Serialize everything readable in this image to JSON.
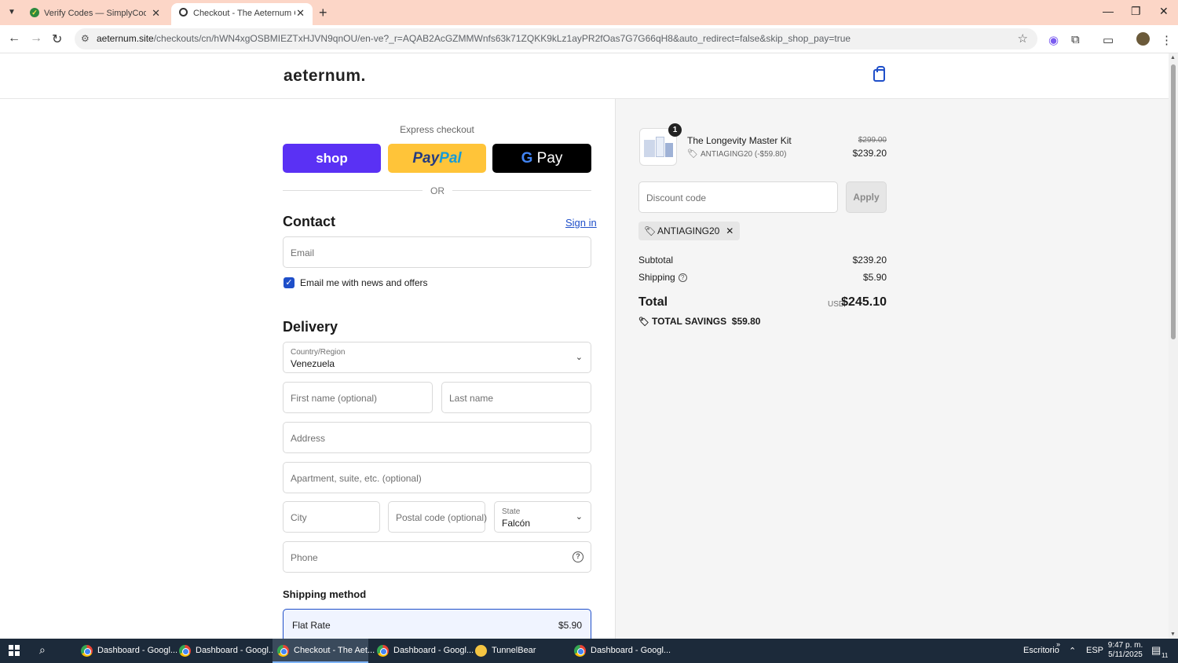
{
  "browser": {
    "tabs": [
      {
        "label": "Verify Codes — SimplyCodes",
        "active": false
      },
      {
        "label": "Checkout - The Aeternum Com",
        "active": true
      }
    ],
    "url_host": "aeternum.site",
    "url_path": "/checkouts/cn/hWN4xgOSBMIEZTxHJVN9qnOU/en-ve?_r=AQAB2AcGZMMWnfs63k71ZQKK9kLz1ayPR2fOas7G7G66qH8&auto_redirect=false&skip_shop_pay=true"
  },
  "store": {
    "logo": "aeternum."
  },
  "express": {
    "heading": "Express checkout",
    "shop_label": "shop",
    "paypal_a": "Pay",
    "paypal_b": "Pal",
    "gpay_g": "G",
    "gpay_label": "Pay",
    "or_label": "OR"
  },
  "contact": {
    "heading": "Contact",
    "signin_label": "Sign in",
    "email_placeholder": "Email",
    "newsletter_label": "Email me with news and offers",
    "newsletter_checked": true
  },
  "delivery": {
    "heading": "Delivery",
    "country_label": "Country/Region",
    "country_value": "Venezuela",
    "first_name_placeholder": "First name (optional)",
    "last_name_placeholder": "Last name",
    "address_placeholder": "Address",
    "apartment_placeholder": "Apartment, suite, etc. (optional)",
    "city_placeholder": "City",
    "postal_placeholder": "Postal code (optional)",
    "state_label": "State",
    "state_value": "Falcón",
    "phone_placeholder": "Phone"
  },
  "shipping_method": {
    "heading": "Shipping method",
    "option_name": "Flat Rate",
    "option_price": "$5.90"
  },
  "summary": {
    "item": {
      "name": "The Longevity Master Kit",
      "quantity": "1",
      "discount_line": "ANTIAGING20 (-$59.80)",
      "original_price": "$299.00",
      "price": "$239.20"
    },
    "discount_placeholder": "Discount code",
    "apply_label": "Apply",
    "applied_code": "ANTIAGING20",
    "subtotal_label": "Subtotal",
    "subtotal_value": "$239.20",
    "shipping_label": "Shipping",
    "shipping_value": "$5.90",
    "total_label": "Total",
    "total_currency": "USD",
    "total_value": "$245.10",
    "savings_label": "TOTAL SAVINGS",
    "savings_value": "$59.80"
  },
  "taskbar": {
    "apps": [
      {
        "label": "Dashboard - Googl...",
        "active": false
      },
      {
        "label": "Dashboard - Googl...",
        "active": false
      },
      {
        "label": "Checkout - The Aet...",
        "active": true
      },
      {
        "label": "Dashboard - Googl...",
        "active": false
      },
      {
        "label": "TunnelBear",
        "active": false
      },
      {
        "label": "Dashboard - Googl...",
        "active": false
      }
    ],
    "desktop_label": "Escritorio",
    "language": "ESP",
    "time": "9:47 p. m.",
    "date": "5/11/2025",
    "notification_count": "11"
  },
  "colors": {
    "accent": "#1f4fc9",
    "shop_purple": "#5a31f4",
    "paypal_yellow": "#ffc439",
    "tabbar_bg": "#fcd6c7"
  }
}
